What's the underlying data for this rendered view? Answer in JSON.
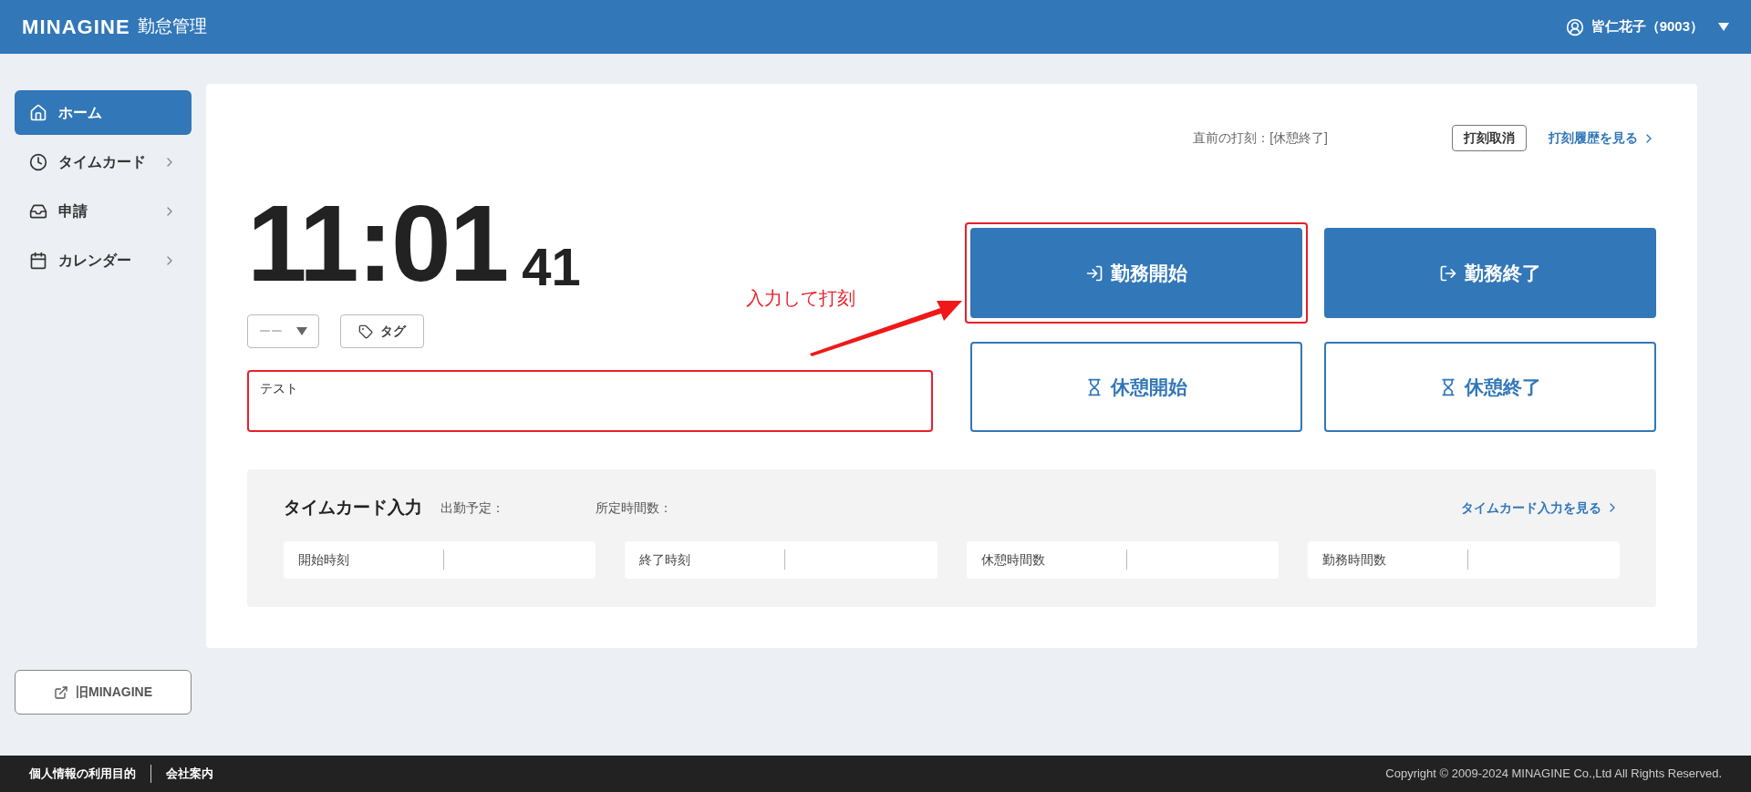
{
  "header": {
    "logo": "MINAGINE",
    "app_name": "勤怠管理",
    "user": "皆仁花子（9003）"
  },
  "sidebar": {
    "items": [
      {
        "label": "ホーム",
        "kind": "home",
        "selected": true,
        "expandable": false
      },
      {
        "label": "タイムカード",
        "kind": "clock",
        "selected": false,
        "expandable": true
      },
      {
        "label": "申請",
        "kind": "trays",
        "selected": false,
        "expandable": true
      },
      {
        "label": "カレンダー",
        "kind": "calendar",
        "selected": false,
        "expandable": true
      }
    ],
    "legacy_button": "旧MINAGINE"
  },
  "last_punch": {
    "label": "直前の打刻：[休憩終了]",
    "cancel_button": "打刻取消",
    "history_link": "打刻履歴を見る"
  },
  "clock": {
    "time": "11:01",
    "seconds": "41"
  },
  "select": {
    "value": "ーー"
  },
  "tag_button": "タグ",
  "memo": {
    "value": "テスト",
    "highlighted": true
  },
  "annotation": "入力して打刻",
  "punch_buttons": [
    {
      "label": "勤務開始",
      "kind": "clock_in",
      "filled": true,
      "highlighted": true
    },
    {
      "label": "勤務終了",
      "kind": "clock_out",
      "filled": true,
      "highlighted": false
    },
    {
      "label": "休憩開始",
      "kind": "break_start",
      "filled": false,
      "highlighted": false
    },
    {
      "label": "休憩終了",
      "kind": "break_end",
      "filled": false,
      "highlighted": false
    }
  ],
  "timecard": {
    "title": "タイムカード入力",
    "scheduled_label": "出勤予定：",
    "hours_label": "所定時間数：",
    "link": "タイムカード入力を見る",
    "fields": [
      "開始時刻",
      "終了時刻",
      "休憩時間数",
      "勤務時間数"
    ]
  },
  "footer": {
    "links": [
      "個人情報の利用目的",
      "会社案内"
    ],
    "copyright": "Copyright © 2009-2024 MINAGINE Co.,Ltd All Rights Reserved."
  }
}
